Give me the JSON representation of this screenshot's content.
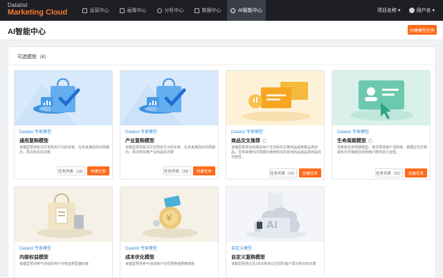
{
  "app": {
    "logo_top": "Datatist",
    "logo_bottom": "Marketing Cloud"
  },
  "nav": [
    {
      "label": "运营中心",
      "icon": "box-icon",
      "active": false
    },
    {
      "label": "画像中心",
      "icon": "card-icon",
      "active": false
    },
    {
      "label": "分析中心",
      "icon": "chart-icon",
      "active": false
    },
    {
      "label": "数据中心",
      "icon": "database-icon",
      "active": false
    },
    {
      "label": "AI智能中心",
      "icon": "ai-icon",
      "active": true
    }
  ],
  "top_right": {
    "project": "项目名称 ▾",
    "user": "用户名 ▾"
  },
  "page": {
    "title": "AI智能中心",
    "create_button": "创建模型任务"
  },
  "panel": {
    "header": "可选模型（4）"
  },
  "cards": [
    {
      "category": "Datatist 专家模型",
      "name": "通用复购模型",
      "info": false,
      "desc": "该模型预测有过历史购买行为的买家，在未来某段时间周期内，再次购买的次数",
      "list_label": "任务列表（18）",
      "create_label": "创建任务",
      "image": "shopping-bag-illustration"
    },
    {
      "category": "Datatist 专家模型",
      "name": "产业复购模型",
      "info": false,
      "desc": "该模型预测有过历史购买行为的买家，在未来某段时间周期内，再次购买某产业商品的次数",
      "list_label": "任务列表（28）",
      "create_label": "创建任务",
      "image": "shopping-bag-illustration"
    },
    {
      "category": "Datatist 专家模型",
      "name": "商品交叉推荐",
      "info": true,
      "desc": "该模型预测当前相关用户过去购买过某商品或某某品类商品，在将来某时间周期内继续购买的其他商品或品类商品的可能性。",
      "list_label": "任务列表（10）",
      "create_label": "创建任务",
      "image": "cards-illustration"
    },
    {
      "category": "Datatist 专家模型",
      "name": "生命周期模型",
      "info": true,
      "desc": "洞悉衡生命周期模型，按月预测用户活跃度，根据正向迁移或负向迁移路径标明用户群体进行运营。",
      "list_label": "任务列表（32）",
      "create_label": "创建任务",
      "image": "profile-card-illustration"
    },
    {
      "category": "Datatist 专家模型",
      "name": "内部权益模型",
      "info": false,
      "desc": "该模型预测参与活动的用户对权益类型偏好度",
      "image": "gift-bag-illustration"
    },
    {
      "category": "Datatist 专家模型",
      "name": "成本优化模型",
      "info": false,
      "desc": "该模型预测参与活动用户对优惠券金额敏感度",
      "image": "coin-illustration"
    },
    {
      "category": "自定义模型",
      "name": "自定义复购模型",
      "info": false,
      "desc": "该模型预测过去1年内购买过空调的客户再次购买的次数",
      "image": "ai-cloud-illustration"
    }
  ]
}
